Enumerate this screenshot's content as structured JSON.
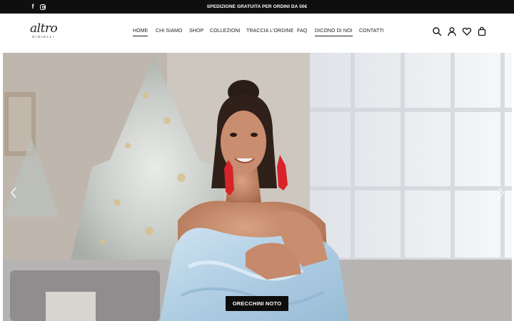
{
  "topbar": {
    "promo_text": "SPEDIZIONE GRATUITA PER ORDINI DA 50€",
    "social_icons": [
      "facebook-icon",
      "instagram-icon"
    ]
  },
  "header": {
    "logo_script": "altro",
    "logo_sub": "GIOIELLI",
    "nav": [
      {
        "label": "HOME",
        "active": true
      },
      {
        "label": "CHI SIAMO",
        "active": false
      },
      {
        "label": "SHOP",
        "active": false
      },
      {
        "label": "COLLEZIONI",
        "active": false
      },
      {
        "label": "TRACCIA L'ORDINE",
        "active": false
      },
      {
        "label": "FAQ",
        "active": false
      },
      {
        "label": "DICONO DI NOI",
        "active": true
      },
      {
        "label": "CONTATTI",
        "active": false
      }
    ],
    "icons": [
      "search-icon",
      "user-icon",
      "heart-icon",
      "bag-icon"
    ]
  },
  "hero": {
    "cta_label": "ORECCHINI NOTO",
    "arrows": [
      "chevron-left-icon",
      "chevron-right-icon"
    ]
  },
  "colors": {
    "topbar_bg": "#0f0f0f",
    "button_bg": "#0d0d0d",
    "dress": "#bcd7ea",
    "earrings": "#d8232a"
  }
}
